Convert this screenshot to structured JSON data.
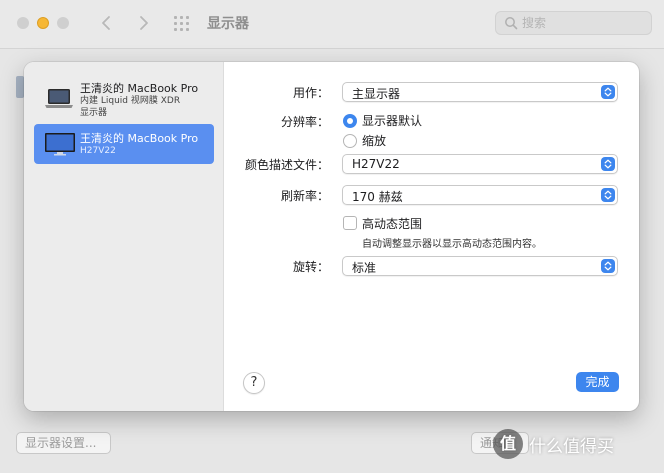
{
  "window": {
    "title": "显示器",
    "search_placeholder": "搜索"
  },
  "sidebar": {
    "devices": [
      {
        "name": "王清炎的 MacBook Pro",
        "sub1": "内建 Liquid 视网膜 XDR",
        "sub2": "显示器",
        "selected": false,
        "icon": "laptop-icon"
      },
      {
        "name": "王清炎的 MacBook Pro",
        "sub1": "H27V22",
        "selected": true,
        "icon": "monitor-icon"
      }
    ]
  },
  "settings": {
    "use_as": {
      "label": "用作：",
      "value": "主显示器"
    },
    "resolution": {
      "label": "分辨率：",
      "options": [
        {
          "label": "显示器默认",
          "selected": true
        },
        {
          "label": "缩放",
          "selected": false
        }
      ]
    },
    "color_profile": {
      "label": "颜色描述文件：",
      "value": "H27V22"
    },
    "refresh_rate": {
      "label": "刷新率：",
      "value": "170 赫兹"
    },
    "hdr": {
      "label": "高动态范围",
      "checked": false,
      "hint": "自动调整显示器以显示高动态范围内容。"
    },
    "rotation": {
      "label": "旋转：",
      "value": "标准"
    }
  },
  "buttons": {
    "help": "?",
    "done": "完成",
    "display_settings": "显示器设置...",
    "notify": "通知"
  },
  "watermark": {
    "logo": "值",
    "text": "什么值得买"
  },
  "colors": {
    "accent": "#3d86ee",
    "selection": "#5a8ff0",
    "minimize_light": "#f6b735"
  }
}
